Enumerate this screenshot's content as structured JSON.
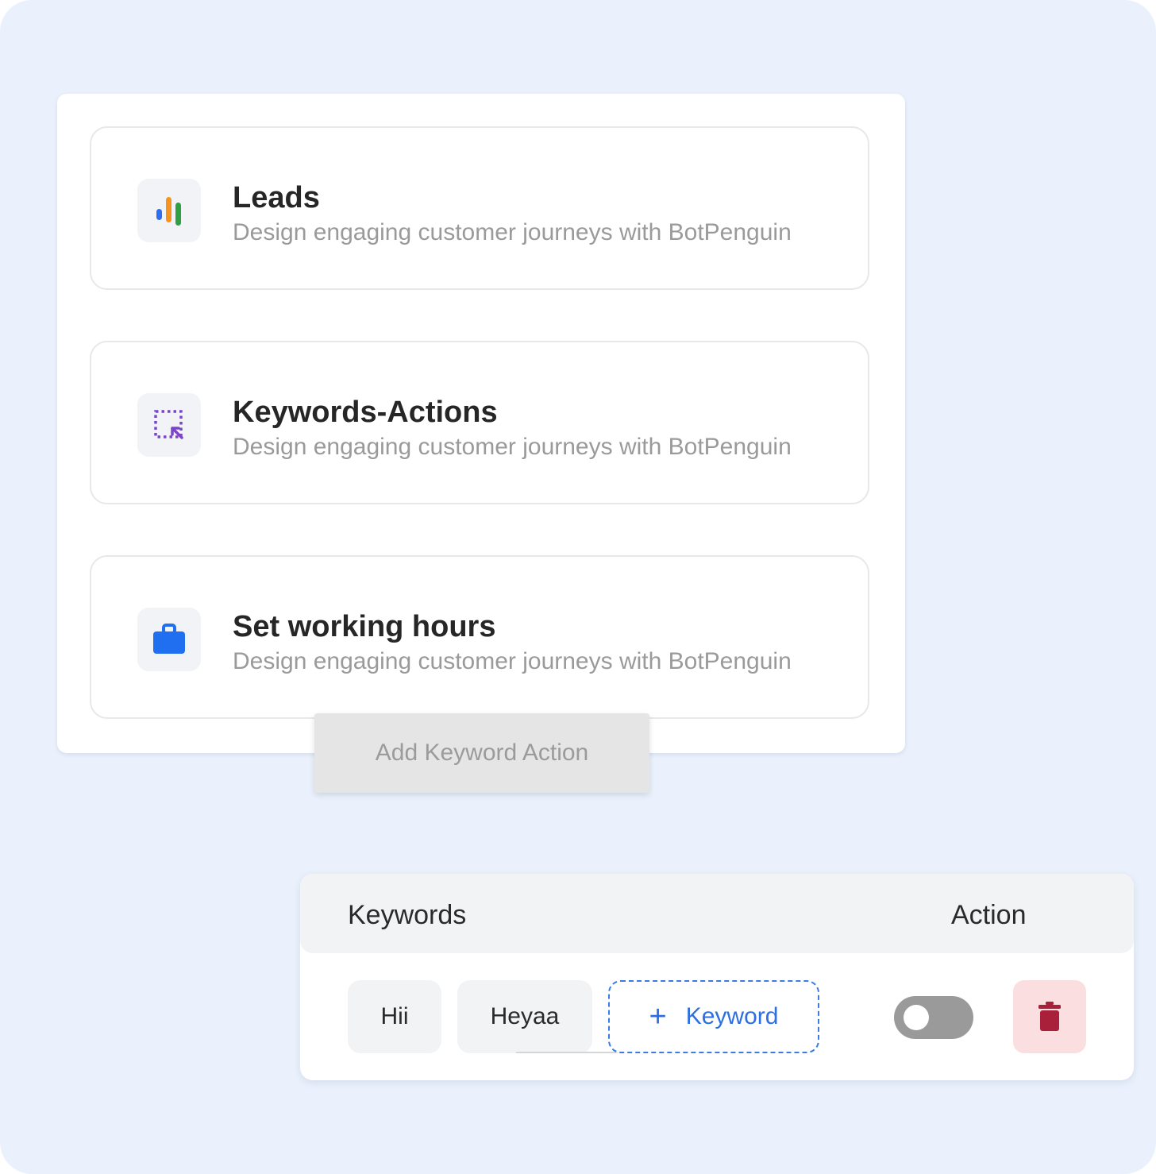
{
  "features": [
    {
      "title": "Leads",
      "description": "Design engaging customer journeys with BotPenguin",
      "icon": "bar-chart-icon"
    },
    {
      "title": "Keywords-Actions",
      "description": "Design engaging customer journeys with BotPenguin",
      "icon": "select-cursor-icon"
    },
    {
      "title": "Set working hours",
      "description": "Design engaging customer journeys with BotPenguin",
      "icon": "briefcase-icon"
    }
  ],
  "add_action_label": "Add Keyword Action",
  "keywords_table": {
    "headers": {
      "keywords": "Keywords",
      "action": "Action"
    },
    "keywords": [
      "Hii",
      "Heyaa"
    ],
    "add_keyword_label": "Keyword",
    "toggle_on": false
  },
  "colors": {
    "background": "#eaf1fc",
    "accent_blue": "#2d6fe0",
    "delete_red": "#a8203a",
    "delete_bg": "#fbdfe0",
    "toggle_off": "#9a9a9a"
  }
}
